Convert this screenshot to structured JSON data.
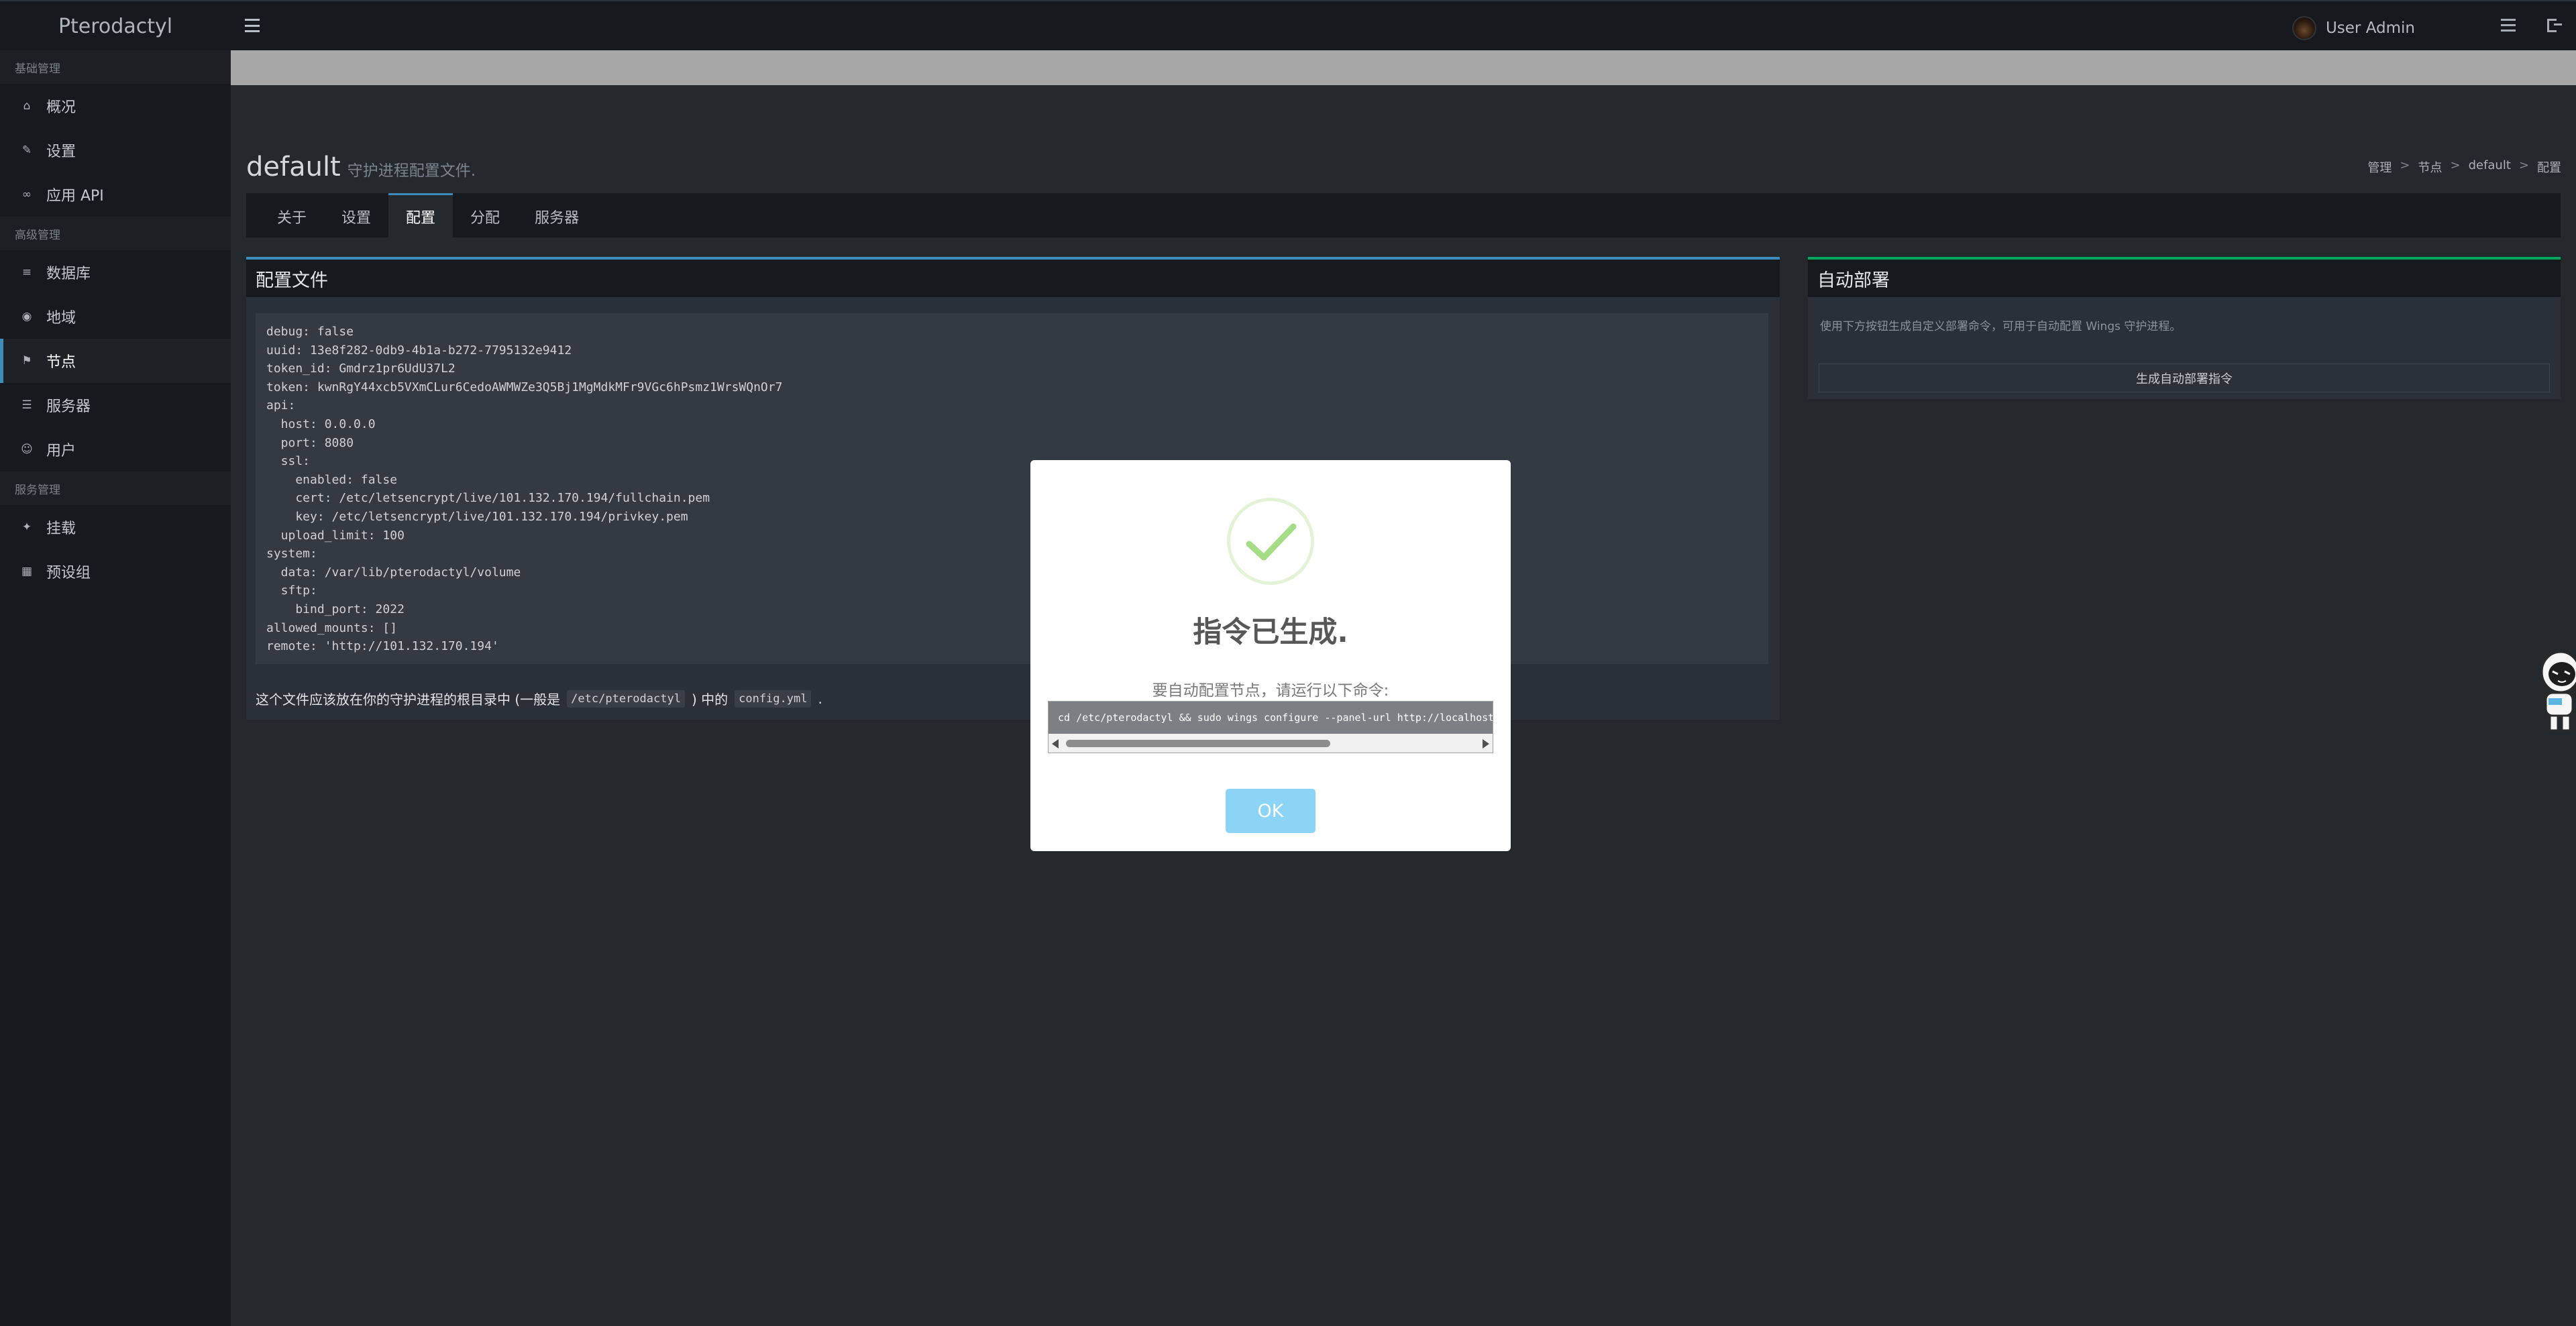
{
  "app": {
    "brand": "Pterodactyl"
  },
  "header": {
    "user_name": "User Admin"
  },
  "sidebar": {
    "sections": [
      {
        "title": "基础管理",
        "items": [
          {
            "label": "概况",
            "icon": "home-icon"
          },
          {
            "label": "设置",
            "icon": "wrench-icon"
          },
          {
            "label": "应用 API",
            "icon": "link-icon"
          }
        ]
      },
      {
        "title": "高级管理",
        "items": [
          {
            "label": "数据库",
            "icon": "database-icon"
          },
          {
            "label": "地域",
            "icon": "globe-icon"
          },
          {
            "label": "节点",
            "icon": "sitemap-icon",
            "active": true
          },
          {
            "label": "服务器",
            "icon": "list-icon"
          },
          {
            "label": "用户",
            "icon": "users-icon"
          }
        ]
      },
      {
        "title": "服务管理",
        "items": [
          {
            "label": "挂载",
            "icon": "magic-icon"
          },
          {
            "label": "预设组",
            "icon": "th-large-icon"
          }
        ]
      }
    ]
  },
  "page": {
    "title": "default",
    "subtitle": "守护进程配置文件.",
    "breadcrumb": [
      "管理",
      "节点",
      "default",
      "配置"
    ]
  },
  "tabs": [
    "关于",
    "设置",
    "配置",
    "分配",
    "服务器"
  ],
  "active_tab": "配置",
  "config_box": {
    "title": "配置文件",
    "code": "debug: false\nuuid: 13e8f282-0db9-4b1a-b272-7795132e9412\ntoken_id: Gmdrz1pr6UdU37L2\ntoken: kwnRgY44xcb5VXmCLur6CedoAWMWZe3Q5Bj1MgMdkMFr9VGc6hPsmz1WrsWQnOr7\napi:\n  host: 0.0.0.0\n  port: 8080\n  ssl:\n    enabled: false\n    cert: /etc/letsencrypt/live/101.132.170.194/fullchain.pem\n    key: /etc/letsencrypt/live/101.132.170.194/privkey.pem\n  upload_limit: 100\nsystem:\n  data: /var/lib/pterodactyl/volume\n  sftp:\n    bind_port: 2022\nallowed_mounts: []\nremote: 'http://101.132.170.194'",
    "note_prefix": "这个文件应该放在你的守护进程的根目录中 (一般是",
    "note_path": "/etc/pterodactyl",
    "note_mid": ") 中的",
    "note_file": "config.yml",
    "note_suffix": "."
  },
  "deploy_box": {
    "title": "自动部署",
    "description": "使用下方按钮生成自定义部署命令，可用于自动配置 Wings 守护进程。",
    "button": "生成自动部署指令"
  },
  "modal": {
    "title": "指令已生成.",
    "text": "要自动配置节点，请运行以下命令:",
    "command": "cd /etc/pterodactyl && sudo wings configure --panel-url http://localhost",
    "ok": "OK",
    "success_color": "#a5dc86",
    "button_color": "#8cd4f5"
  }
}
